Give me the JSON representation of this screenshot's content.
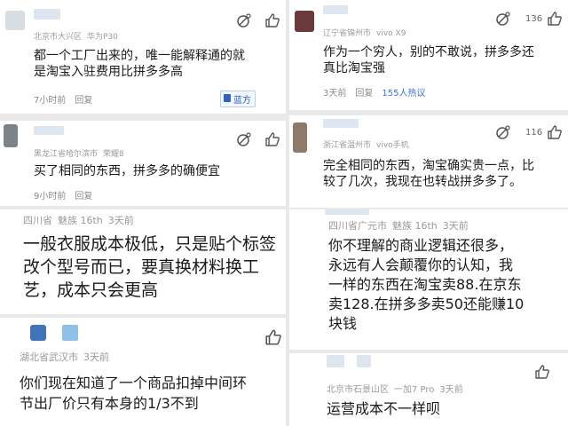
{
  "comments": {
    "c1": {
      "meta": [
        "北京市大兴区",
        "华为P30"
      ],
      "text_lines": [
        "都一个工厂出来的，唯一能解释通的就",
        "是淘宝入驻费用比拼多多高"
      ],
      "time": "7小时前",
      "reply": "回复",
      "badge": "蓝方"
    },
    "c2": {
      "meta": [
        "辽宁省锦州市",
        "vivo X9"
      ],
      "text_lines": [
        "作为一个穷人，别的不敢说，拼多多还",
        "真比淘宝强"
      ],
      "time": "3天前",
      "reply": "回复",
      "hot": "155人热议",
      "likes": "136"
    },
    "c3": {
      "meta": [
        "黑龙江省哈尔滨市",
        "荣耀8"
      ],
      "text_lines": [
        "买了相同的东西，拼多多的确便宜"
      ],
      "time": "9小时前",
      "reply": "回复"
    },
    "c4": {
      "meta": [
        "浙江省温州市",
        "vivo手机"
      ],
      "text_lines": [
        "完全相同的东西，淘宝确实贵一点，比",
        "较了几次，我现在也转战拼多多了。"
      ],
      "likes": "116"
    },
    "c5": {
      "meta": [
        "四川省",
        "魅族 16th",
        "3天前"
      ],
      "text_lines": [
        "一般衣服成本极低，只是贴个标签",
        "改个型号而已，要真换材料换工",
        "艺，成本只会更高"
      ]
    },
    "c6": {
      "meta": [
        "四川省广元市",
        "魅族 16th",
        "3天前"
      ],
      "text_lines": [
        "你不理解的商业逻辑还很多，",
        "永远有人会颠覆你的认知，我",
        "一样的东西在淘宝卖88.在京东",
        "卖128.在拼多多卖50还能赚10",
        "块钱"
      ]
    },
    "c7": {
      "meta": [
        "湖北省武汉市",
        "3天前"
      ],
      "text_lines": [
        "你们现在知道了一个商品扣掉中间环",
        "节出厂价只有本身的1/3不到"
      ]
    },
    "c8": {
      "meta": [
        "北京市石景山区",
        "一加7 Pro",
        "3天前"
      ],
      "text_lines": [
        "运营成本不一样呗"
      ]
    }
  },
  "colors": {
    "link": "#3a6fd8",
    "meta": "#9a9a9a",
    "background": "#e9e9e9"
  },
  "icons": [
    "dislike-icon",
    "like-icon",
    "blue-side-flag-icon"
  ]
}
